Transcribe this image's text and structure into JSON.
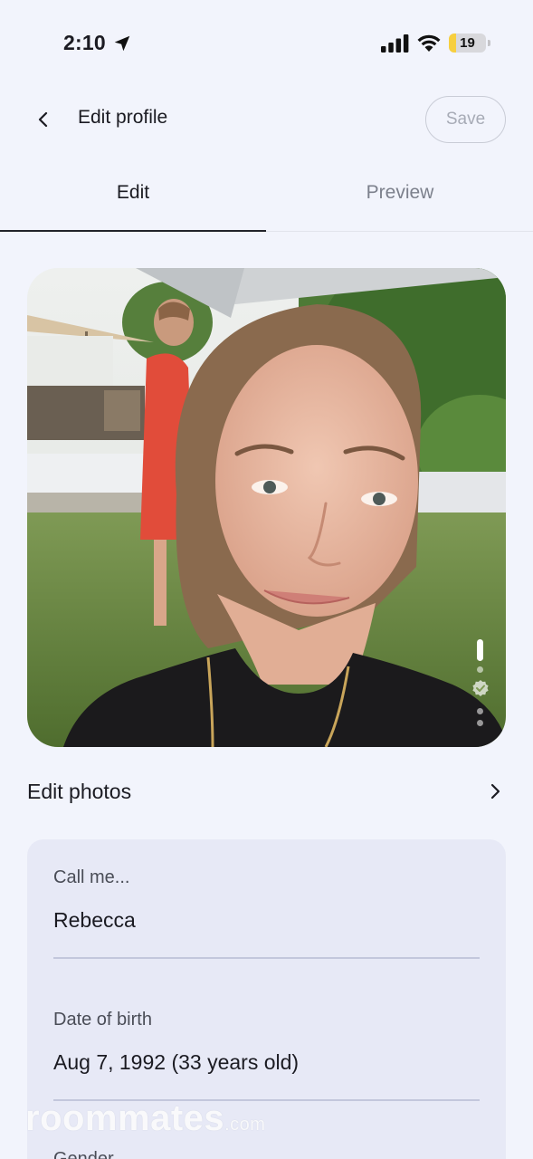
{
  "status_bar": {
    "time": "2:10",
    "battery_level": "19",
    "battery_fraction": 0.19,
    "icons": [
      "location-arrow-icon",
      "cellular-signal-icon",
      "wifi-icon",
      "battery-icon"
    ]
  },
  "header": {
    "title": "Edit profile",
    "save_label": "Save",
    "back_icon": "chevron-left-icon"
  },
  "tabs": [
    {
      "label": "Edit",
      "active": true
    },
    {
      "label": "Preview",
      "active": false
    }
  ],
  "photo": {
    "description_icon": "profile-photo",
    "indicator_count": 4,
    "active_index": 0
  },
  "edit_photos": {
    "label": "Edit photos",
    "icon": "chevron-right-icon"
  },
  "form": {
    "fields": [
      {
        "label": "Call me...",
        "value": "Rebecca"
      },
      {
        "label": "Date of birth",
        "value": "Aug 7, 1992 (33 years old)"
      },
      {
        "label": "Gender",
        "value": ""
      }
    ]
  },
  "watermark": {
    "brand": "roommates",
    "suffix": ".com"
  },
  "colors": {
    "background": "#f2f4fc",
    "card": "#e7e9f6",
    "text_primary": "#1b1b22",
    "text_muted": "#7c808c",
    "battery_yellow": "#f7cf3f"
  }
}
